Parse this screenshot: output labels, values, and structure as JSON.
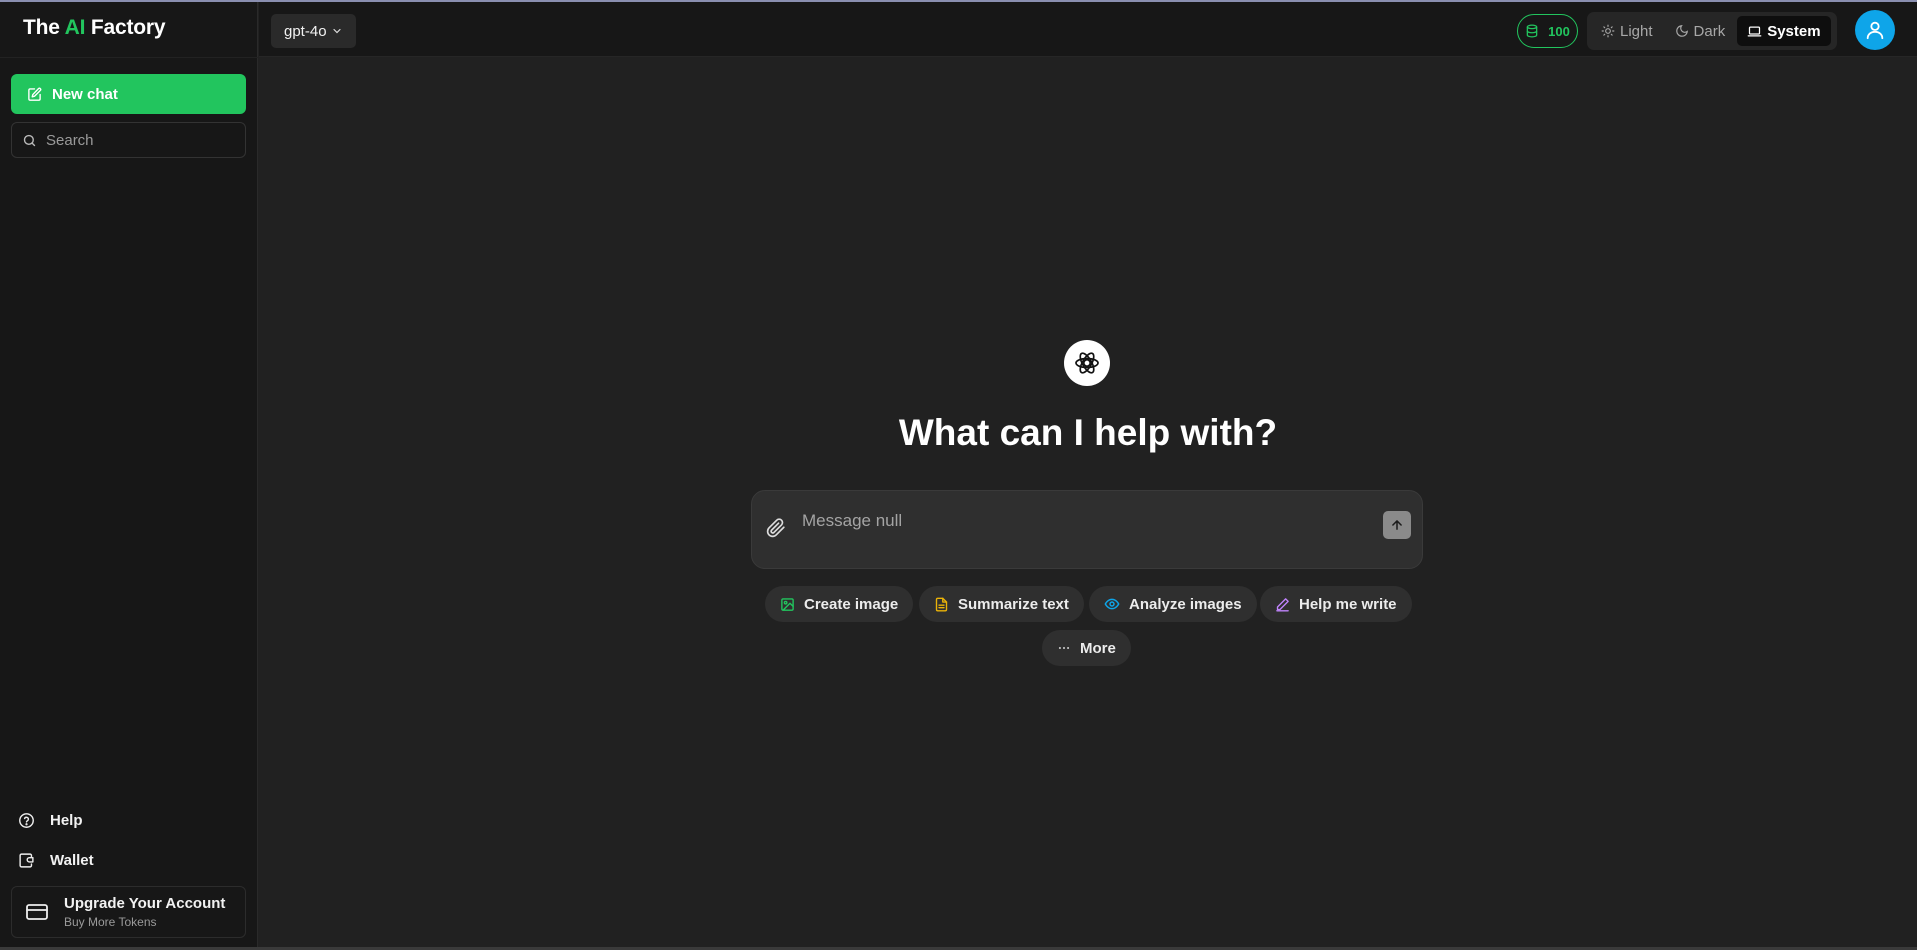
{
  "brand": {
    "prefix": "The",
    "highlight": "AI",
    "suffix": "Factory"
  },
  "sidebar": {
    "new_chat": "New chat",
    "search_placeholder": "Search",
    "help": "Help",
    "wallet": "Wallet",
    "upgrade_title": "Upgrade Your Account",
    "upgrade_subtitle": "Buy More Tokens"
  },
  "header": {
    "model": "gpt-4o",
    "tokens": "100",
    "theme": {
      "light": "Light",
      "dark": "Dark",
      "system": "System",
      "selected": "System"
    }
  },
  "main": {
    "headline": "What can I help with?",
    "composer_placeholder": "Message null",
    "suggestions": [
      {
        "label": "Create image",
        "icon": "image-icon",
        "color": "#22c55e"
      },
      {
        "label": "Summarize text",
        "icon": "document-icon",
        "color": "#eab308"
      },
      {
        "label": "Analyze images",
        "icon": "eye-icon",
        "color": "#0ea5e9"
      },
      {
        "label": "Help me write",
        "icon": "pen-icon",
        "color": "#c084fc"
      },
      {
        "label": "More",
        "icon": "more-icon",
        "color": "#cccccc"
      }
    ]
  },
  "colors": {
    "accent": "#22c55e",
    "avatar": "#0ea5e9",
    "background": "#212121",
    "sidebar": "#171717"
  }
}
